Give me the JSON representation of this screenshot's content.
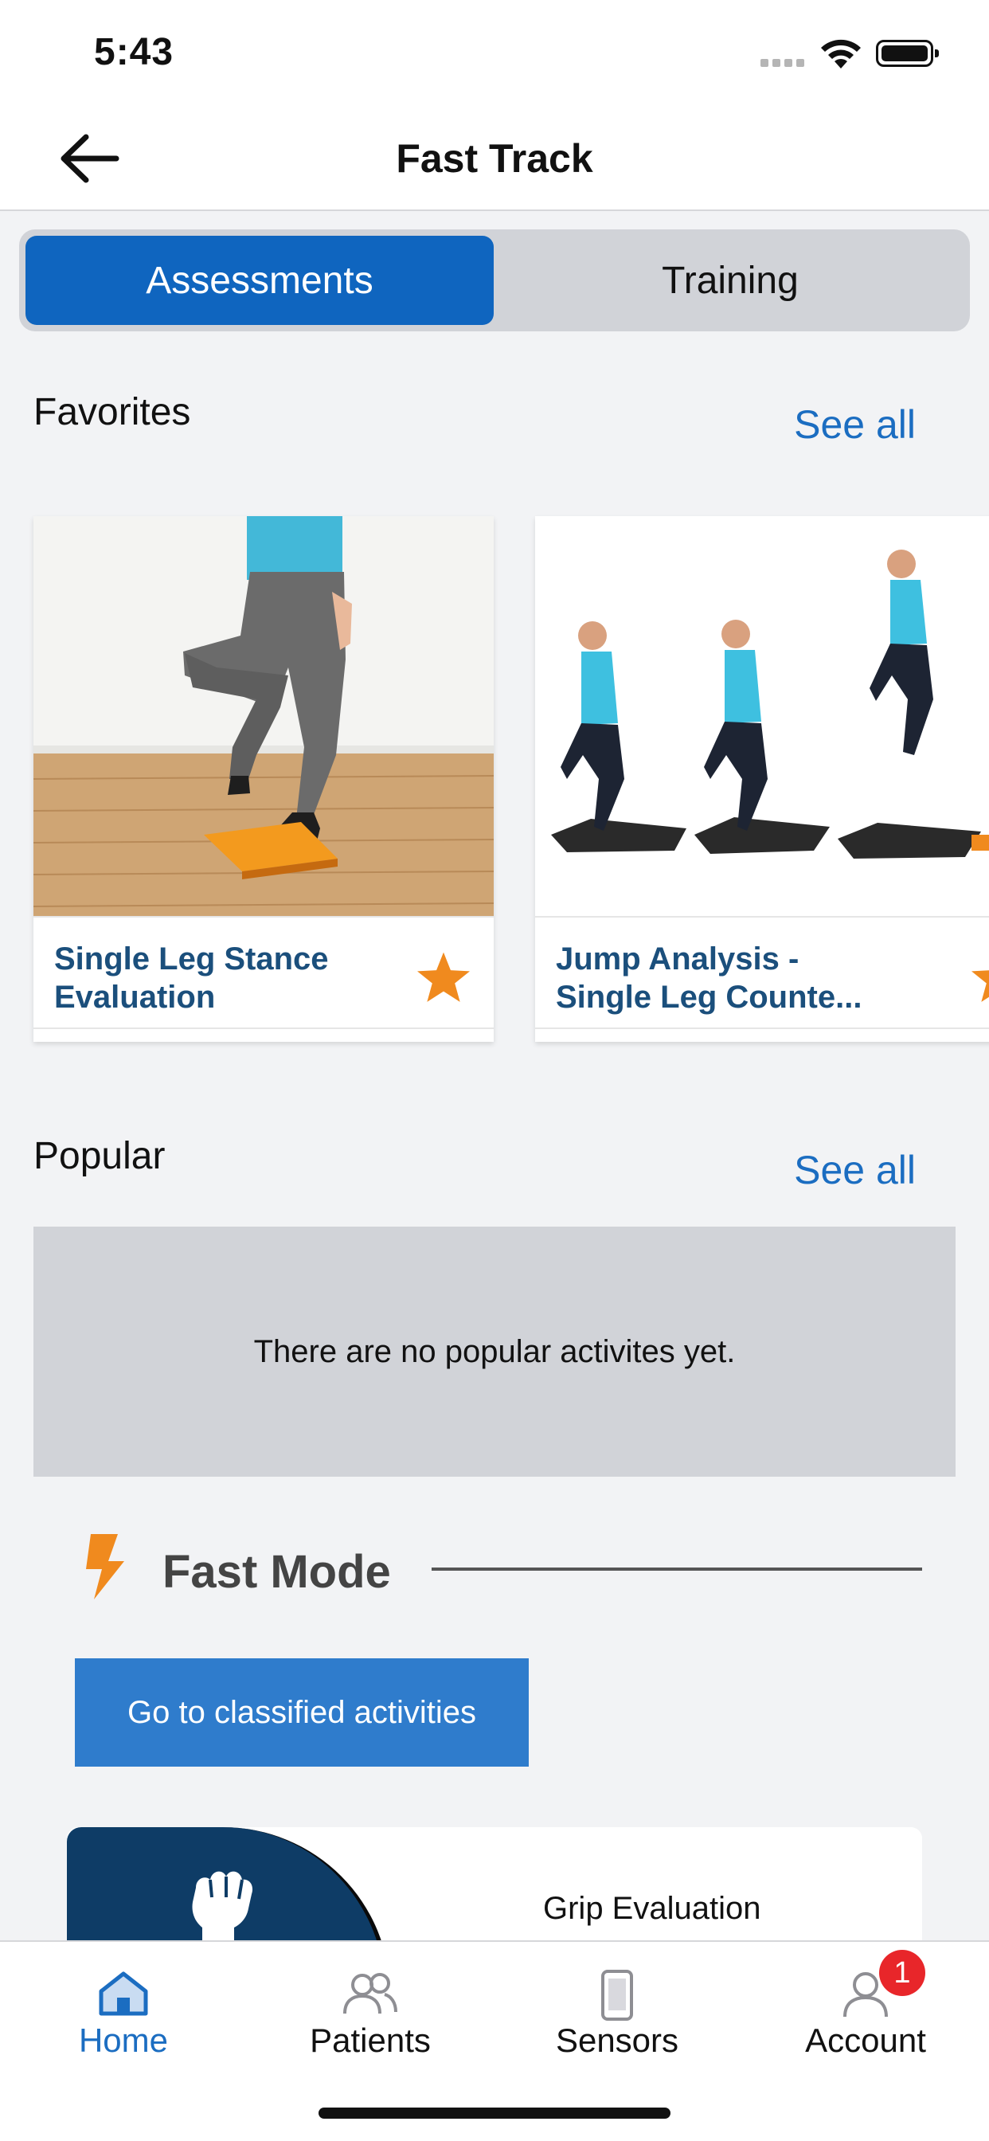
{
  "status_bar": {
    "time": "5:43"
  },
  "nav": {
    "title": "Fast Track"
  },
  "segments": {
    "assessments": "Assessments",
    "training": "Training"
  },
  "favorites": {
    "title": "Favorites",
    "see_all": "See all",
    "cards": [
      {
        "title": "Single Leg Stance\nEvaluation",
        "favorite": true
      },
      {
        "title": "Jump Analysis -\nSingle Leg Counte...",
        "favorite": true
      }
    ]
  },
  "popular": {
    "title": "Popular",
    "see_all": "See all",
    "empty_message": "There are no popular activites yet."
  },
  "fast_mode": {
    "title": "Fast Mode",
    "button_label": "Go to classified activities",
    "activity_label": "Grip Evaluation"
  },
  "tab_bar": {
    "items": [
      {
        "label": "Home",
        "icon": "home-icon",
        "active": true
      },
      {
        "label": "Patients",
        "icon": "patients-icon",
        "active": false
      },
      {
        "label": "Sensors",
        "icon": "sensors-icon",
        "active": false
      },
      {
        "label": "Account",
        "icon": "account-icon",
        "active": false,
        "badge": "1"
      }
    ]
  },
  "colors": {
    "accent": "#0f65bf",
    "link": "#1b6dc1",
    "star": "#f08a1e",
    "badge": "#e8262a"
  }
}
